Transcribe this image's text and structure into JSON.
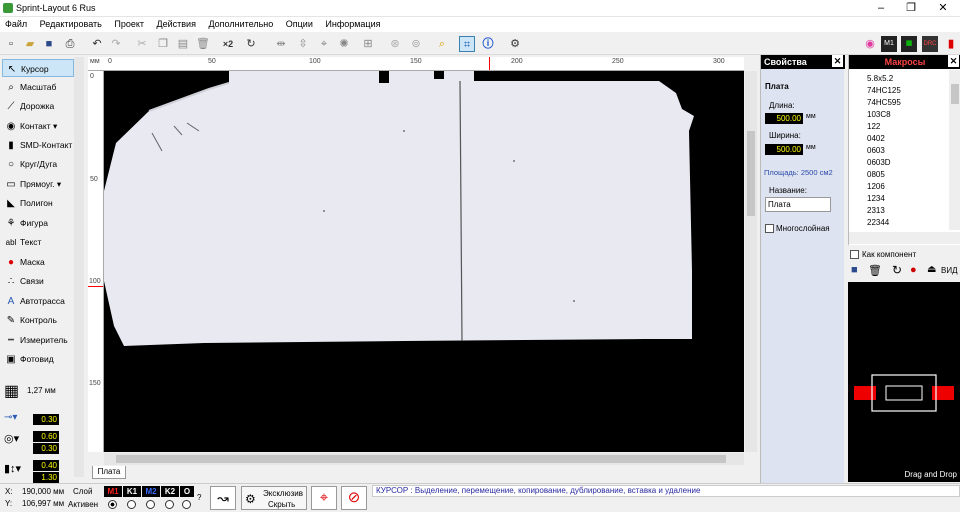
{
  "window": {
    "title": "Sprint-Layout 6 Rus",
    "buttons": [
      "‒",
      "❐",
      "✕"
    ]
  },
  "menu": [
    "Файл",
    "Редактировать",
    "Проект",
    "Действия",
    "Дополнительно",
    "Опции",
    "Информация"
  ],
  "tools": [
    {
      "label": "Курсор",
      "icon": "cursor-icon"
    },
    {
      "label": "Масштаб",
      "icon": "zoom-icon"
    },
    {
      "label": "Дорожка",
      "icon": "track-icon"
    },
    {
      "label": "Контакт",
      "icon": "pad-icon"
    },
    {
      "label": "SMD-Контакт",
      "icon": "smd-pad-icon"
    },
    {
      "label": "Круг/Дуга",
      "icon": "circle-icon"
    },
    {
      "label": "Прямоуг.",
      "icon": "rect-icon"
    },
    {
      "label": "Полигон",
      "icon": "polygon-icon"
    },
    {
      "label": "Фигура",
      "icon": "shape-icon"
    },
    {
      "label": "Текст",
      "icon": "text-icon"
    },
    {
      "label": "Маска",
      "icon": "mask-icon"
    },
    {
      "label": "Связи",
      "icon": "connections-icon"
    },
    {
      "label": "Автотрасса",
      "icon": "autoroute-icon"
    },
    {
      "label": "Контроль",
      "icon": "check-icon"
    },
    {
      "label": "Измеритель",
      "icon": "measure-icon"
    },
    {
      "label": "Фотовид",
      "icon": "photoview-icon"
    }
  ],
  "grid": "1,27 мм",
  "track_values": {
    "track_width": "0.30",
    "pad_outer": "0.60",
    "pad_inner": "0.30",
    "smd_w": "0.40",
    "smd_h": "1.30"
  },
  "ruler": {
    "unit": "мм",
    "top": [
      "0",
      "50",
      "100",
      "150",
      "200",
      "250",
      "300"
    ],
    "left": [
      "0",
      "50",
      "100",
      "150"
    ]
  },
  "sheet_tab": "Плата",
  "properties": {
    "header": "Свойства",
    "section": "Плата",
    "length_label": "Длина:",
    "length_value": "500.00",
    "width_label": "Ширина:",
    "width_value": "500.00",
    "unit": "мм",
    "area": "Площадь: 2500 см2",
    "name_label": "Название:",
    "name_value": "Плата",
    "multilayer": "Многослойная"
  },
  "macros": {
    "header": "Макросы",
    "items": [
      "5.8x5.2",
      "74HC125",
      "74HC595",
      "103C8",
      "122",
      "0402",
      "0603",
      "0603D",
      "0805",
      "1206",
      "1234",
      "2313",
      "22344"
    ],
    "as_component": "Как компонент",
    "view": "ВИД",
    "drag_drop": "Drag and Drop"
  },
  "status": {
    "x_label": "X:",
    "x_value": "190,000 мм",
    "y_label": "Y:",
    "y_value": "106,997 мм",
    "layer_label": "Слой",
    "active_label": "Активен",
    "layers": [
      "M1",
      "K1",
      "M2",
      "K2",
      "O"
    ],
    "layer_colors": [
      "#ff2020",
      "#ffffff",
      "#3a6aff",
      "#ffffff",
      "#ffffff"
    ],
    "excl_top": "Эксклюзив",
    "excl_bottom": "Скрыть",
    "help": "КУРСОР  : Выделение, перемещение, копирование, дублирование, вставка и удаление"
  }
}
